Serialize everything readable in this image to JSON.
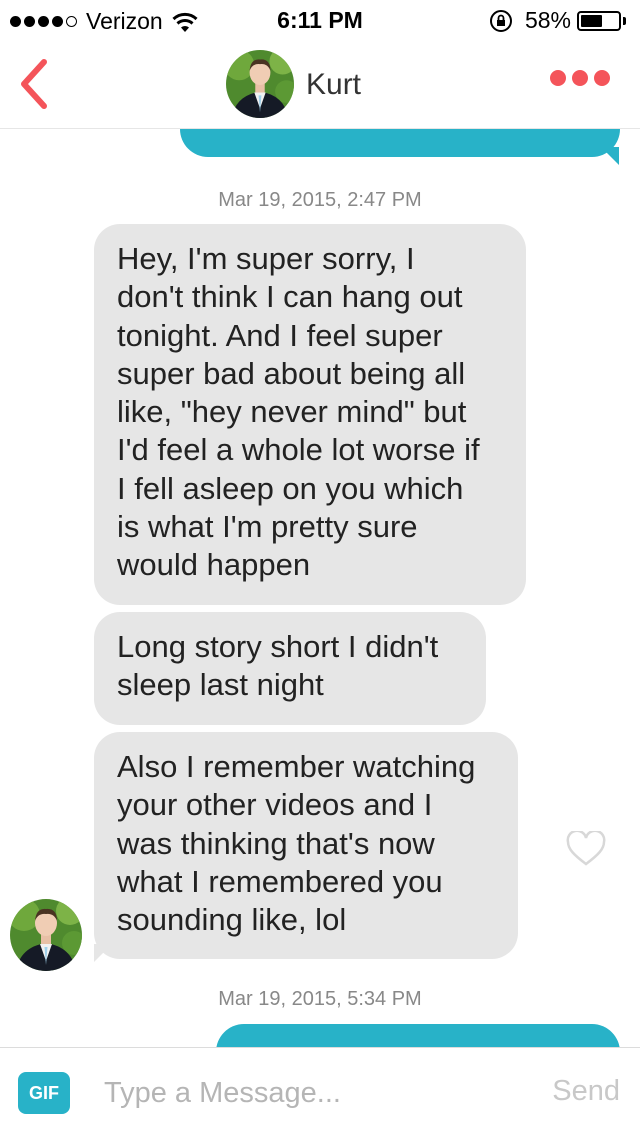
{
  "status_bar": {
    "signal_bars_filled": 4,
    "signal_bars_total": 5,
    "carrier": "Verizon",
    "time": "6:11 PM",
    "battery_percent": "58%",
    "battery_level": 0.58
  },
  "header": {
    "contact_name": "Kurt"
  },
  "conversation": {
    "items": [
      {
        "type": "outgoing-message",
        "text": ""
      },
      {
        "type": "timestamp",
        "text": "Mar 19, 2015, 2:47 PM"
      },
      {
        "type": "incoming-message",
        "lines": [
          "Hey, I'm super sorry, I",
          "don't think I can hang out",
          "tonight. And I feel super",
          "super bad about being all",
          "like, \"hey never mind\" but",
          "I'd feel a whole lot worse if",
          "I fell asleep on you which",
          "is what I'm pretty sure",
          "would happen"
        ]
      },
      {
        "type": "incoming-message",
        "lines": [
          "Long story short I didn't",
          "sleep last night"
        ]
      },
      {
        "type": "incoming-message",
        "liked": false,
        "lines": [
          "Also I remember watching",
          "your other videos and I",
          "was thinking that's now",
          "what I remembered you",
          "sounding like, lol"
        ]
      },
      {
        "type": "timestamp",
        "text": "Mar 19, 2015, 5:34 PM"
      },
      {
        "type": "outgoing-message",
        "text": ""
      }
    ]
  },
  "input_bar": {
    "gif_label": "GIF",
    "placeholder": "Type a Message...",
    "value": "",
    "send_label": "Send"
  },
  "colors": {
    "accent": "#f4545a",
    "outgoing_bubble": "#28b2c8",
    "incoming_bubble": "#e6e6e6"
  },
  "icons": [
    "chevron-left-icon",
    "more-dots-icon",
    "heart-icon",
    "wifi-icon",
    "orientation-lock-icon",
    "battery-icon"
  ]
}
